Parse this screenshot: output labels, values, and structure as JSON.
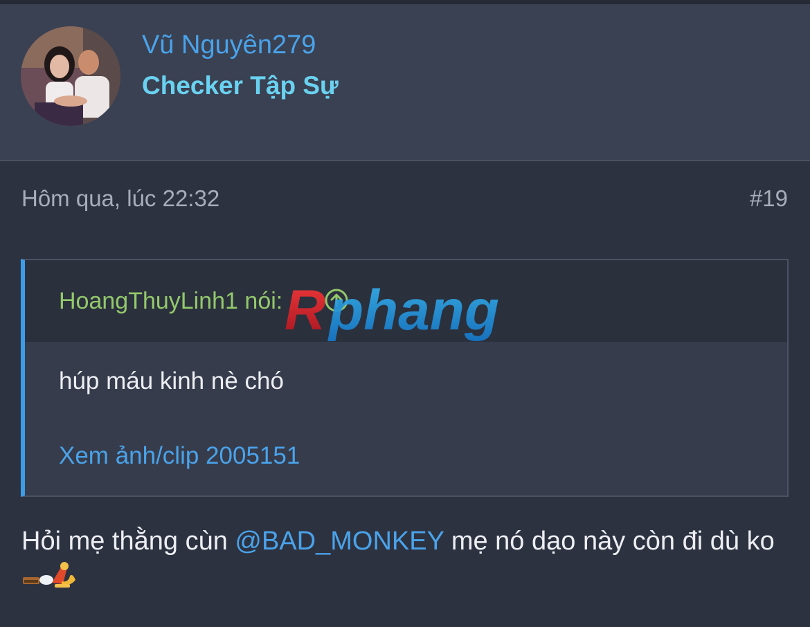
{
  "user": {
    "name": "Vũ Nguyên279",
    "title": "Checker Tập Sự"
  },
  "post": {
    "date": "Hôm qua, lúc 22:32",
    "number": "#19"
  },
  "quote": {
    "author": "HoangThuyLinh1",
    "said_label": "nói:",
    "text": "húp máu kinh nè chó",
    "link": "Xem ảnh/clip 2005151"
  },
  "watermark": {
    "text": "Rphang"
  },
  "message": {
    "before": "Hỏi mẹ thằng cùn ",
    "mention": "@BAD_MONKEY",
    "after": " mẹ nó dạo này còn đi dù ko "
  },
  "colors": {
    "link": "#4aa3ea",
    "title": "#6ad2f0",
    "quote_author": "#93c96b",
    "quote_border": "#3d9de8"
  },
  "icons": {
    "expand": "arrow-up-circle-icon",
    "sticker": "sticker-emoji"
  }
}
